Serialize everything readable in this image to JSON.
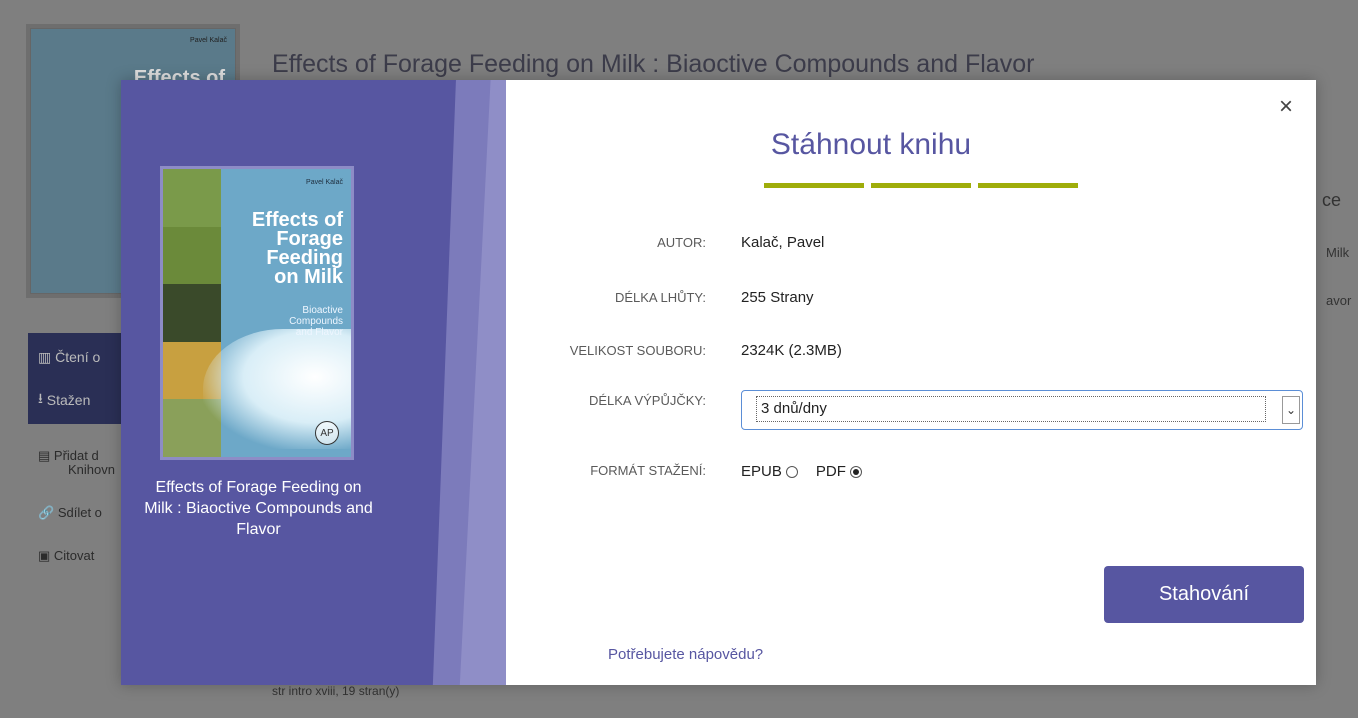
{
  "background": {
    "page_title": "Effects of Forage Feeding on Milk : Biaoctive Compounds and Flavor",
    "cover_author": "Pavel Kalač",
    "cover_title_partial": "Effects of",
    "buttons": [
      "Čtení o",
      "Stažen"
    ],
    "links": [
      "Přidat d",
      "Knihovn",
      "Sdílet o",
      "Citovat"
    ],
    "right_tab": "ce",
    "right_texts": [
      "Milk",
      "avor"
    ],
    "bottom_text": "str intro xviii, 19 stran(y)"
  },
  "modal": {
    "close_label": "×",
    "title": "Stáhnout knihu",
    "accent_color": "#5756a1",
    "underline_color": "#9fad0a",
    "cover": {
      "author": "Pavel Kalač",
      "title_lines": [
        "Effects of",
        "Forage",
        "Feeding",
        "on Milk"
      ],
      "subtitle_lines": [
        "Bioactive",
        "Compounds",
        "and Flavor"
      ],
      "publisher_logo": "AP"
    },
    "book_caption": "Effects of Forage Feeding on Milk : Biaoctive Compounds and Flavor",
    "fields": {
      "author_label": "AUTOR:",
      "author_value": "Kalač, Pavel",
      "length_label": "DÉLKA LHŮTY:",
      "length_value": "255 Strany",
      "size_label": "VELIKOST SOUBORU:",
      "size_value": "2324K (2.3MB)",
      "loan_label": "DÉLKA VÝPŮJČKY:",
      "loan_value": "3 dnů/dny",
      "format_label": "FORMÁT STAŽENÍ:",
      "format_options": [
        "EPUB",
        "PDF"
      ],
      "format_selected": "PDF"
    },
    "download_button": "Stahování",
    "help_link": "Potřebujete nápovědu?"
  }
}
